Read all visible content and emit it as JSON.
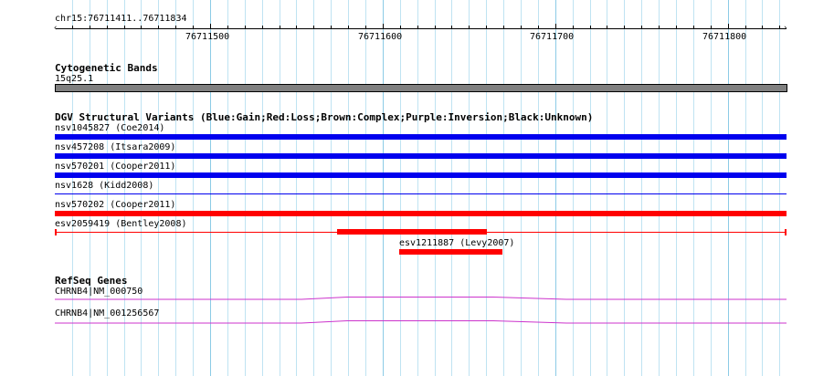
{
  "location": "chr15:76711411..76711834",
  "ruler": {
    "ticks": [
      "76711500",
      "76711600",
      "76711700",
      "76711800"
    ]
  },
  "tracks": {
    "cytoband": {
      "title": "Cytogenetic Bands",
      "band_label": "15q25.1"
    },
    "dgv": {
      "title": "DGV Structural Variants (Blue:Gain;Red:Loss;Brown:Complex;Purple:Inversion;Black:Unknown)",
      "variants": [
        {
          "label": "nsv1045827 (Coe2014)",
          "type": "Gain",
          "color": "#0000ee"
        },
        {
          "label": "nsv457208 (Itsara2009)",
          "type": "Gain",
          "color": "#0000ee"
        },
        {
          "label": "nsv570201 (Cooper2011)",
          "type": "Gain",
          "color": "#0000ee"
        },
        {
          "label": "nsv1628 (Kidd2008)",
          "type": "Gain",
          "color": "#0000ee"
        },
        {
          "label": "nsv570202 (Cooper2011)",
          "type": "Loss",
          "color": "#ff0000"
        },
        {
          "label": "esv2059419 (Bentley2008)",
          "type": "Loss",
          "color": "#ff0000"
        },
        {
          "label": "esv1211887 (Levy2007)",
          "type": "Loss",
          "color": "#ff0000"
        }
      ]
    },
    "refseq": {
      "title": "RefSeq Genes",
      "genes": [
        {
          "label": "CHRNB4|NM_000750",
          "color": "#cc33cc"
        },
        {
          "label": "CHRNB4|NM_001256567",
          "color": "#cc33cc"
        }
      ]
    }
  },
  "colors": {
    "gain": "#0000ee",
    "loss": "#ff0000",
    "grid_major": "#8ccbe6",
    "grid_minor": "#bfe3f2",
    "band": "#808080"
  }
}
